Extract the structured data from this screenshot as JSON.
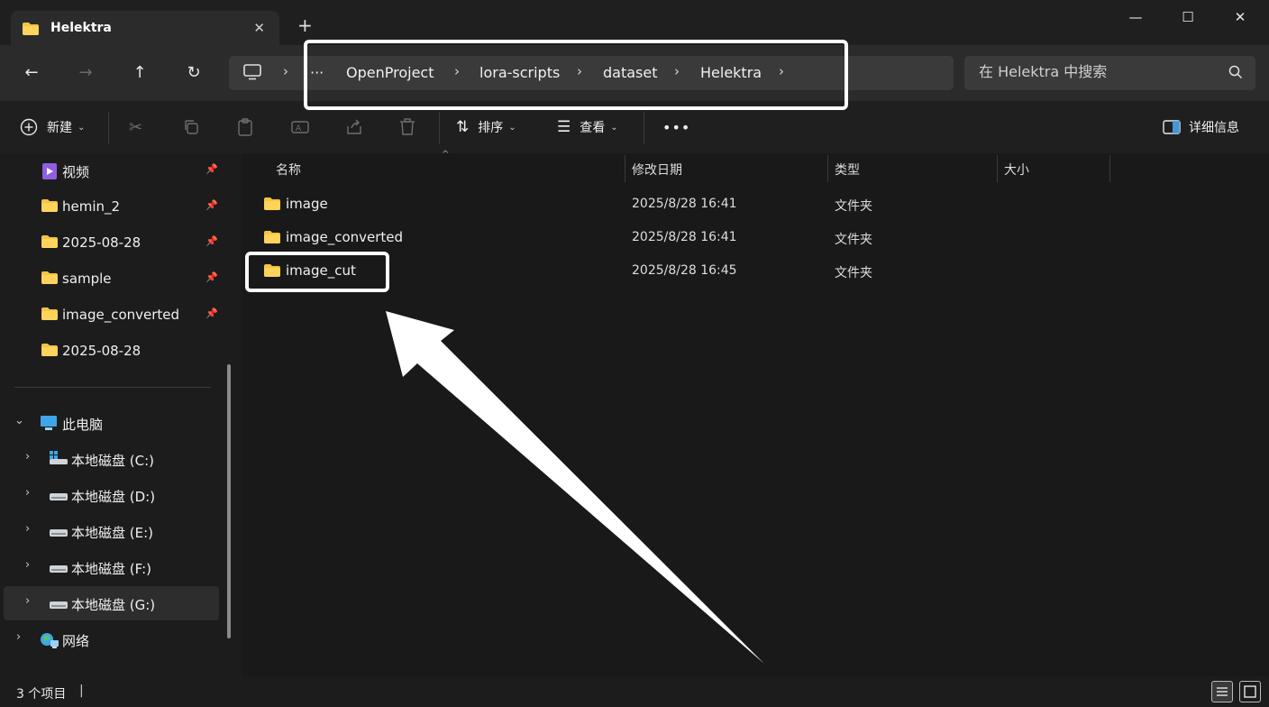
{
  "window": {
    "tab_title": "Helektra",
    "tab_close": "✕",
    "new_tab": "+",
    "minimize": "—",
    "maximize": "☐",
    "close": "✕"
  },
  "nav": {
    "back": "←",
    "forward": "→",
    "up": "↑",
    "refresh": "↻",
    "breadcrumb": [
      "OpenProject",
      "lora-scripts",
      "dataset",
      "Helektra"
    ],
    "more": "···",
    "search_placeholder": "在 Helektra 中搜索"
  },
  "toolbar": {
    "new_label": "新建",
    "sort_label": "排序",
    "view_label": "查看",
    "more": "•••",
    "details_label": "详细信息"
  },
  "sidebar": {
    "quick_access": [
      {
        "label": "视频",
        "icon": "video-folder-icon",
        "pinned": true
      },
      {
        "label": "hemin_2",
        "icon": "folder-icon",
        "pinned": true
      },
      {
        "label": "2025-08-28",
        "icon": "folder-icon",
        "pinned": true
      },
      {
        "label": "sample",
        "icon": "folder-icon",
        "pinned": true
      },
      {
        "label": "image_converted",
        "icon": "folder-icon",
        "pinned": true
      },
      {
        "label": "2025-08-28",
        "icon": "folder-icon",
        "pinned": false
      }
    ],
    "this_pc": "此电脑",
    "drives": [
      {
        "label": "本地磁盘 (C:)",
        "icon": "windows-drive-icon"
      },
      {
        "label": "本地磁盘 (D:)",
        "icon": "drive-icon"
      },
      {
        "label": "本地磁盘 (E:)",
        "icon": "drive-icon"
      },
      {
        "label": "本地磁盘 (F:)",
        "icon": "drive-icon"
      },
      {
        "label": "本地磁盘 (G:)",
        "icon": "drive-icon"
      }
    ],
    "network": "网络"
  },
  "table": {
    "columns": [
      "名称",
      "修改日期",
      "类型",
      "大小"
    ],
    "rows": [
      {
        "name": "image",
        "date": "2025/8/28 16:41",
        "type": "文件夹"
      },
      {
        "name": "image_converted",
        "date": "2025/8/28 16:41",
        "type": "文件夹"
      },
      {
        "name": "image_cut",
        "date": "2025/8/28 16:45",
        "type": "文件夹"
      }
    ]
  },
  "status": {
    "count": "3 个项目"
  },
  "colors": {
    "folder": "#f4c542",
    "background": "#191919",
    "annotation": "#ffffff"
  }
}
